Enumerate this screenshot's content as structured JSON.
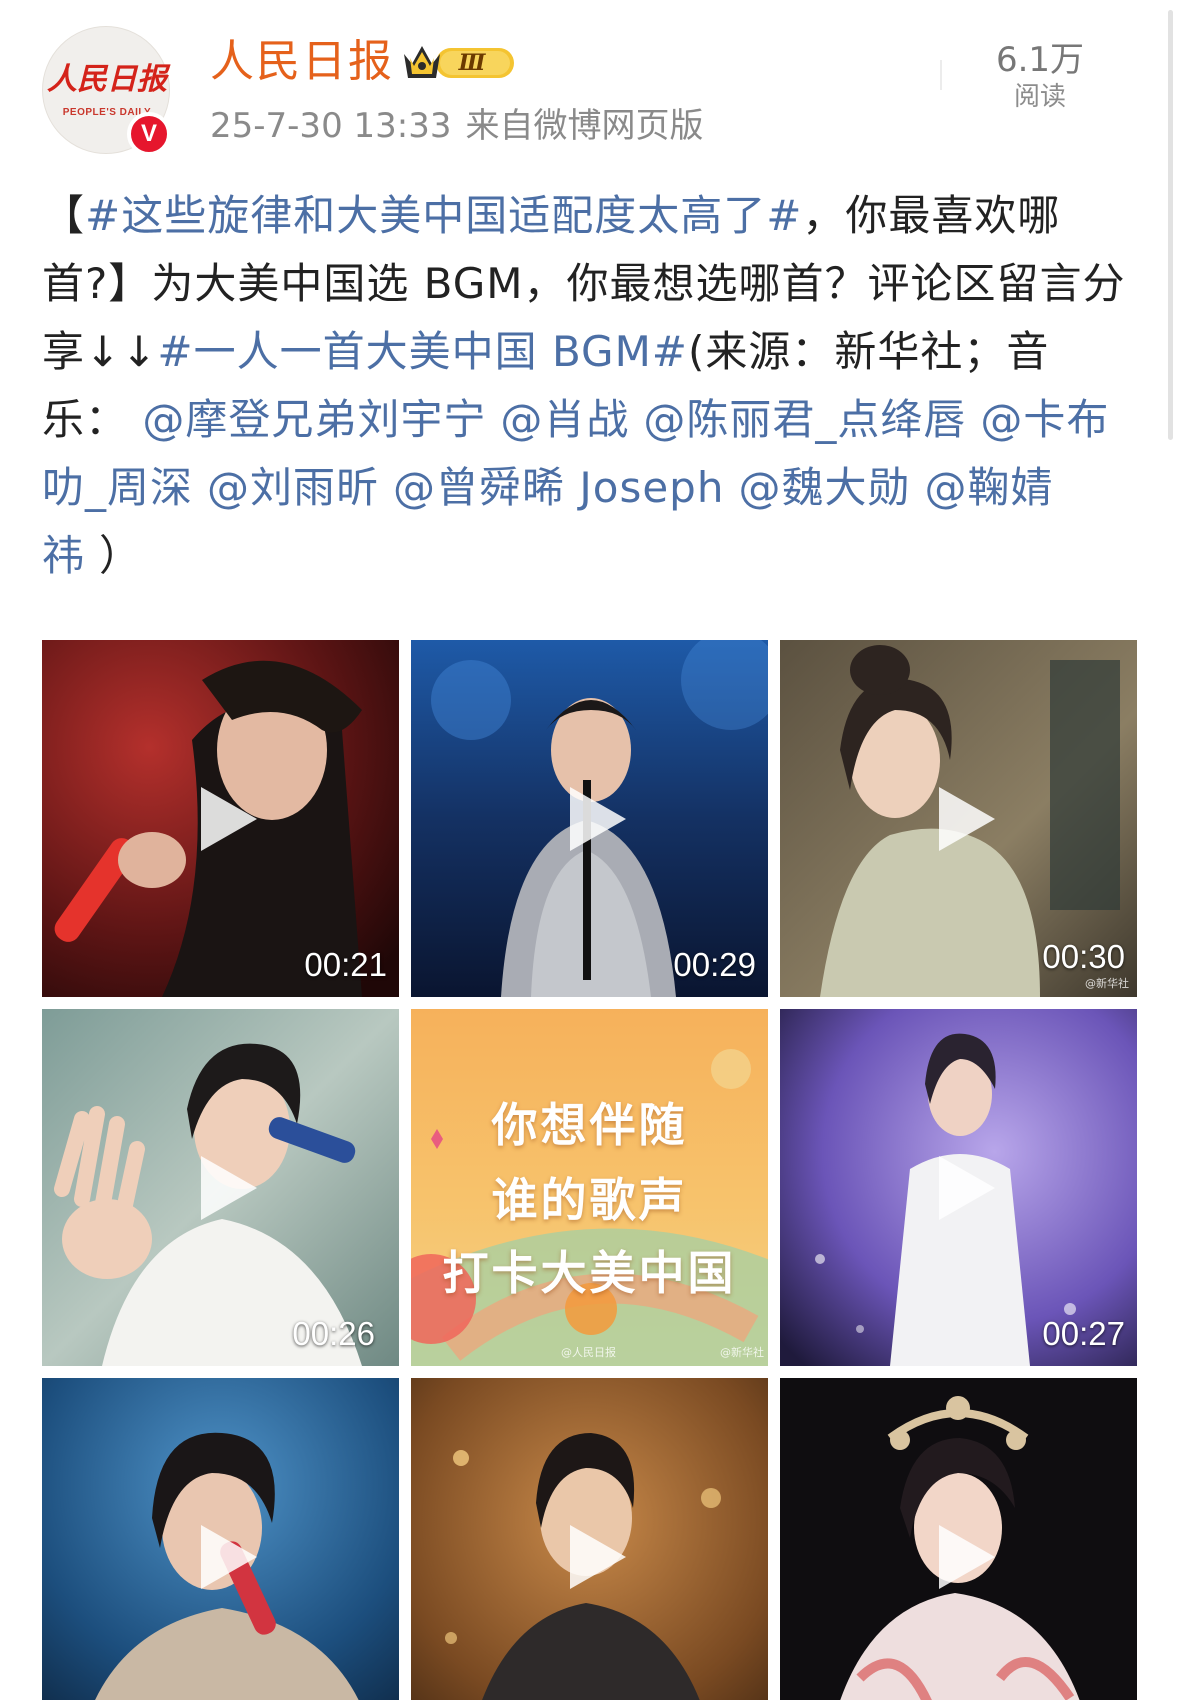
{
  "header": {
    "username": "人民日报",
    "avatar_logo_text": "人民日报",
    "avatar_logo_subtext": "PEOPLE'S DAILY",
    "verified_badge": "V",
    "member_badge_icon": "crown-icon",
    "member_level": "Ⅲ",
    "timestamp": "25-7-30 13:33",
    "source": "来自微博网页版",
    "read_count": "6.1万",
    "read_label": "阅读"
  },
  "post": {
    "open_bracket": "【",
    "hashtag1": "#这些旋律和大美中国适配度太高了#",
    "title_rest": "，你最喜欢哪首?",
    "close_bracket": "】",
    "body_text": "为大美中国选 BGM，你最想选哪首？评论区留言分享",
    "arrows": "↓↓",
    "hashtag2": "#一人一首大美中国 BGM#",
    "source_text": "(来源：新华社；音乐：",
    "mentions": [
      "@摩登兄弟刘宇宁",
      "@肖战",
      "@陈丽君_点绛唇",
      "@卡布叻_周深",
      "@刘雨昕",
      "@曾舜晞 Joseph",
      "@魏大勋",
      "@鞠婧祎"
    ],
    "closing": "）"
  },
  "videos": [
    {
      "duration": "00:21",
      "type": "video"
    },
    {
      "duration": "00:29",
      "type": "video"
    },
    {
      "duration": "00:30",
      "type": "video",
      "watermark": "@新华社"
    },
    {
      "duration": "00:26",
      "type": "video"
    },
    {
      "type": "image",
      "promo_lines": [
        "你想伴随",
        "谁的歌声",
        "打卡大美中国"
      ],
      "watermarks": [
        "@人民日报",
        "@新华社"
      ]
    },
    {
      "duration": "00:27",
      "type": "video"
    },
    {
      "type": "video"
    },
    {
      "type": "video"
    },
    {
      "type": "video"
    }
  ],
  "colors": {
    "username": "#e5611b",
    "link": "#4c6fa5",
    "verified": "#e6162d",
    "meta": "#8a8a8a"
  }
}
